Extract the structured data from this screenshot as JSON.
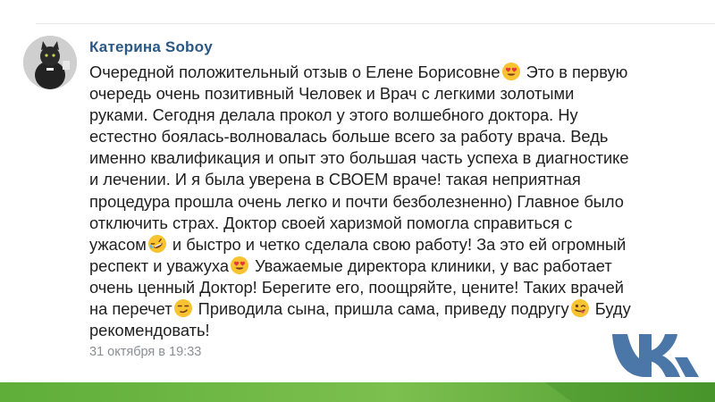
{
  "review": {
    "author": "Катерина Soboy",
    "lines": [
      "Очередной положительный отзыв о Елене Борисовне",
      " Это в первую",
      "очередь очень позитивный Человек и Врач с легкими золотыми",
      "руками. Сегодня делала прокол у этого волшебного доктора. Ну",
      "естестно боялась-волновалась больше всего за работу врача. Ведь",
      "именно квалификация и опыт это большая часть успеха в диагностике",
      "и лечении. И я была уверена в СВОЕМ враче! такая неприятная",
      "процедура прошла очень легко и почти безболезненно) Главное было",
      "отключить страх. Доктор своей харизмой помогла справиться с",
      "ужасом",
      " и быстро и четко сделала свою работу! За это ей огромный",
      "респект и уважуха",
      " Уважаемые директора клиники, у вас работает",
      "очень ценный Доктор! Берегите его, поощряйте, цените! Таких врачей",
      "на перечет",
      " Приводила сына, пришла сама, приведу подругу",
      " Буду",
      "рекомендовать!"
    ],
    "date": "31 октября в 19:33",
    "emojis": [
      "heart-eyes",
      "rolling-laughing",
      "heart-eyes",
      "smirk",
      "winking-tongue"
    ]
  },
  "branding": {
    "logo": "vk-logo",
    "logo_color": "#4a76a8",
    "author_color": "#2a5885",
    "footer_colors": [
      "#5fae3a",
      "#7cc04f",
      "#4c9a2e"
    ]
  }
}
